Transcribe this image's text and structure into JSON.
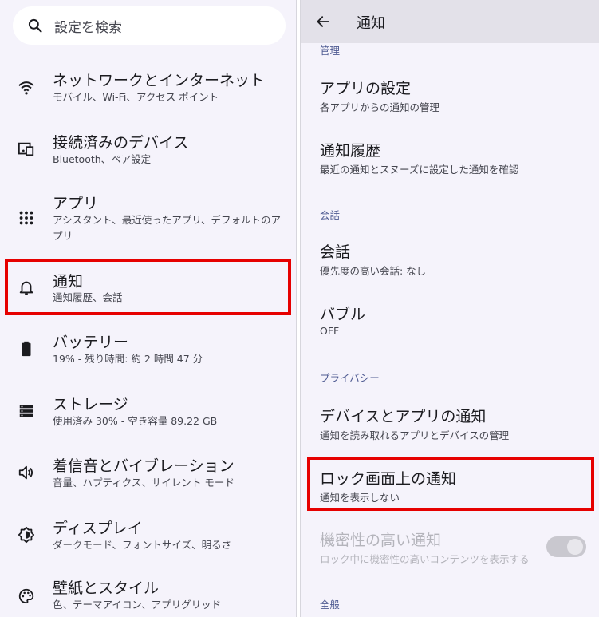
{
  "left": {
    "search": {
      "placeholder": "設定を検索",
      "icon": "search-icon"
    },
    "items": [
      {
        "title": "ネットワークとインターネット",
        "subtitle": "モバイル、Wi-Fi、アクセス ポイント",
        "icon": "wifi-icon"
      },
      {
        "title": "接続済みのデバイス",
        "subtitle": "Bluetooth、ペア設定",
        "icon": "devices-icon"
      },
      {
        "title": "アプリ",
        "subtitle": "アシスタント、最近使ったアプリ、デフォルトのアプリ",
        "icon": "apps-grid-icon"
      },
      {
        "title": "通知",
        "subtitle": "通知履歴、会話",
        "icon": "bell-icon"
      },
      {
        "title": "バッテリー",
        "subtitle": "19% - 残り時間: 約 2 時間 47 分",
        "icon": "battery-icon"
      },
      {
        "title": "ストレージ",
        "subtitle": "使用済み 30% - 空き容量 89.22 GB",
        "icon": "storage-icon"
      },
      {
        "title": "着信音とバイブレーション",
        "subtitle": "音量、ハプティクス、サイレント モード",
        "icon": "volume-icon"
      },
      {
        "title": "ディスプレイ",
        "subtitle": "ダークモード、フォントサイズ、明るさ",
        "icon": "display-icon"
      },
      {
        "title": "壁紙とスタイル",
        "subtitle": "色、テーマアイコン、アプリグリッド",
        "icon": "palette-icon"
      }
    ]
  },
  "right": {
    "header": {
      "title": "通知",
      "back_icon": "back-arrow-icon"
    },
    "sections": {
      "manage": "管理",
      "conversations": "会話",
      "privacy": "プライバシー",
      "general": "全般"
    },
    "items": {
      "app_settings": {
        "title": "アプリの設定",
        "subtitle": "各アプリからの通知の管理"
      },
      "history": {
        "title": "通知履歴",
        "subtitle": "最近の通知とスヌーズに設定した通知を確認"
      },
      "conversations": {
        "title": "会話",
        "subtitle": "優先度の高い会話: なし"
      },
      "bubbles": {
        "title": "バブル",
        "subtitle": "OFF"
      },
      "device_app_notifications": {
        "title": "デバイスとアプリの通知",
        "subtitle": "通知を読み取れるアプリとデバイスの管理"
      },
      "lock_screen": {
        "title": "ロック画面上の通知",
        "subtitle": "通知を表示しない"
      },
      "sensitive": {
        "title": "機密性の高い通知",
        "subtitle": "ロック中に機密性の高いコンテンツを表示する",
        "toggle": "on-disabled"
      }
    }
  },
  "colors": {
    "highlight": "#e60000",
    "accent": "#4f5b92",
    "background": "#f5f3fb"
  }
}
